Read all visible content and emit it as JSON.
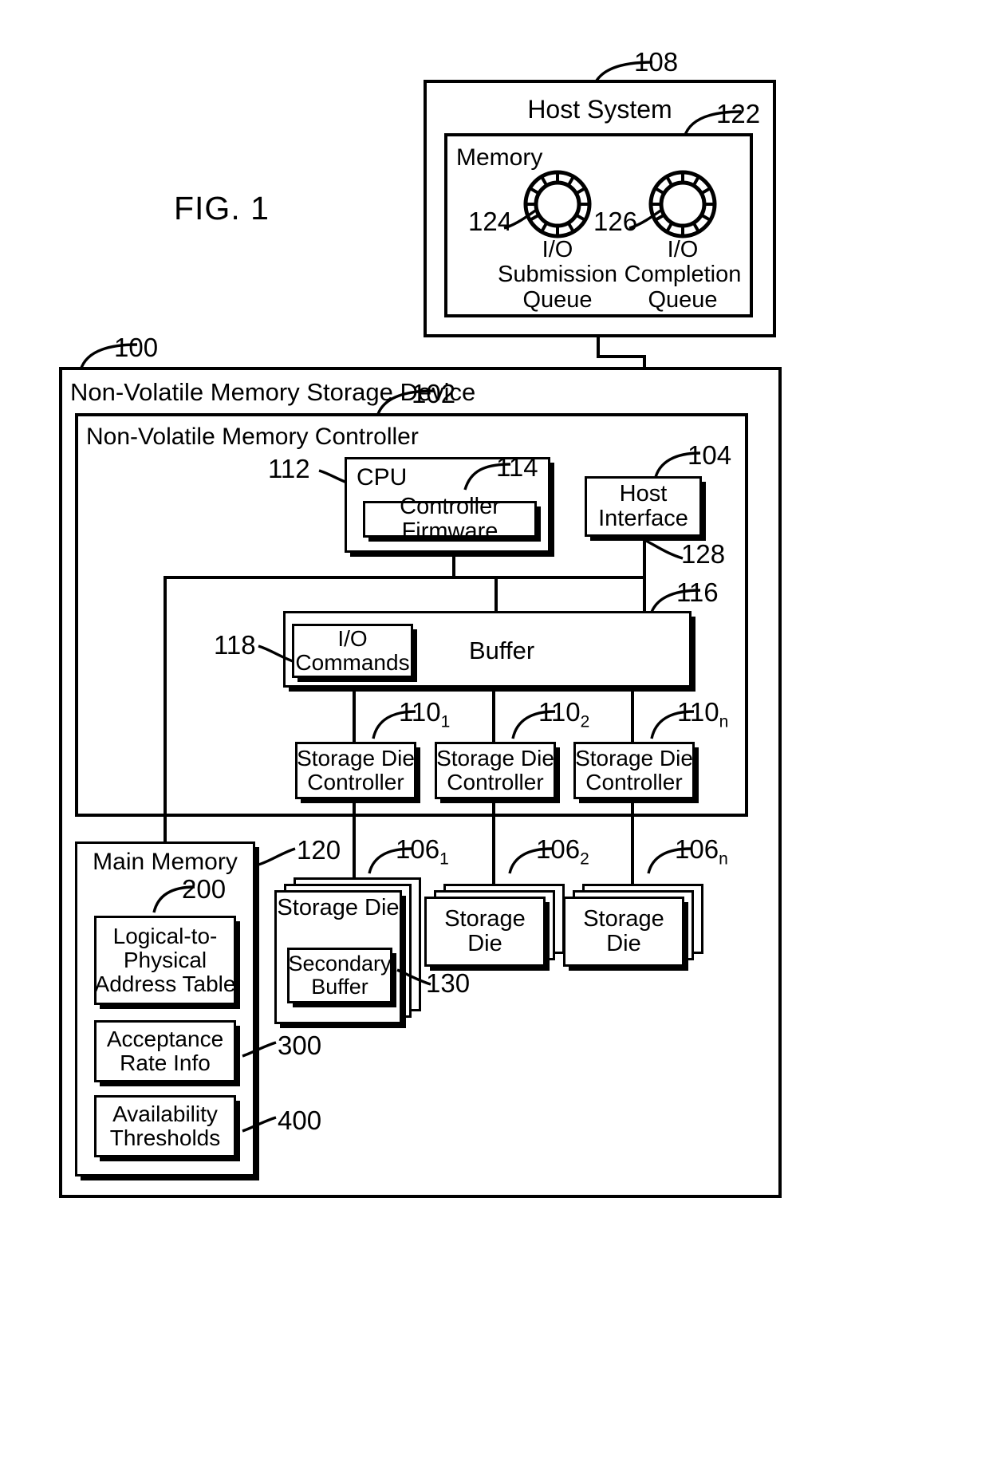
{
  "figure": {
    "title": "FIG. 1"
  },
  "host": {
    "ref": "108",
    "title": "Host System",
    "memory": {
      "ref": "122",
      "title": "Memory",
      "queues": [
        {
          "ref": "124",
          "line1": "I/O",
          "line2": "Submission",
          "line3": "Queue",
          "icon": "ring-queue-icon"
        },
        {
          "ref": "126",
          "line1": "I/O",
          "line2": "Completion",
          "line3": "Queue",
          "icon": "ring-queue-icon"
        }
      ]
    }
  },
  "device": {
    "ref": "100",
    "title": "Non-Volatile Memory Storage Device",
    "controller": {
      "ref": "102",
      "title": "Non-Volatile Memory Controller",
      "cpu": {
        "ref": "112",
        "title": "CPU",
        "firmware": {
          "ref": "114",
          "title": "Controller Firmware"
        }
      },
      "host_interface": {
        "ref": "104",
        "line1": "Host",
        "line2": "Interface",
        "bus_ref": "128"
      },
      "buffer": {
        "ref": "116",
        "title": "Buffer",
        "io_commands": {
          "ref": "118",
          "line1": "I/O",
          "line2": "Commands"
        }
      },
      "die_controllers": [
        {
          "ref": "110",
          "sub": "1",
          "line1": "Storage Die",
          "line2": "Controller"
        },
        {
          "ref": "110",
          "sub": "2",
          "line1": "Storage Die",
          "line2": "Controller"
        },
        {
          "ref": "110",
          "sub": "n",
          "line1": "Storage Die",
          "line2": "Controller"
        }
      ]
    },
    "main_memory": {
      "ref": "120",
      "title": "Main Memory",
      "items": [
        {
          "ref": "200",
          "line1": "Logical-to-",
          "line2": "Physical",
          "line3": "Address Table"
        },
        {
          "ref": "300",
          "line1": "Acceptance",
          "line2": "Rate Info"
        },
        {
          "ref": "400",
          "line1": "Availability",
          "line2": "Thresholds"
        }
      ]
    },
    "storage_dies": [
      {
        "ref": "106",
        "sub": "1",
        "title": "Storage Die",
        "secondary_buffer": {
          "ref": "130",
          "line1": "Secondary",
          "line2": "Buffer"
        }
      },
      {
        "ref": "106",
        "sub": "2",
        "title": "Storage Die"
      },
      {
        "ref": "106",
        "sub": "n",
        "title": "Storage Die"
      }
    ]
  },
  "colors": {
    "ink": "#000000",
    "paper": "#ffffff"
  }
}
